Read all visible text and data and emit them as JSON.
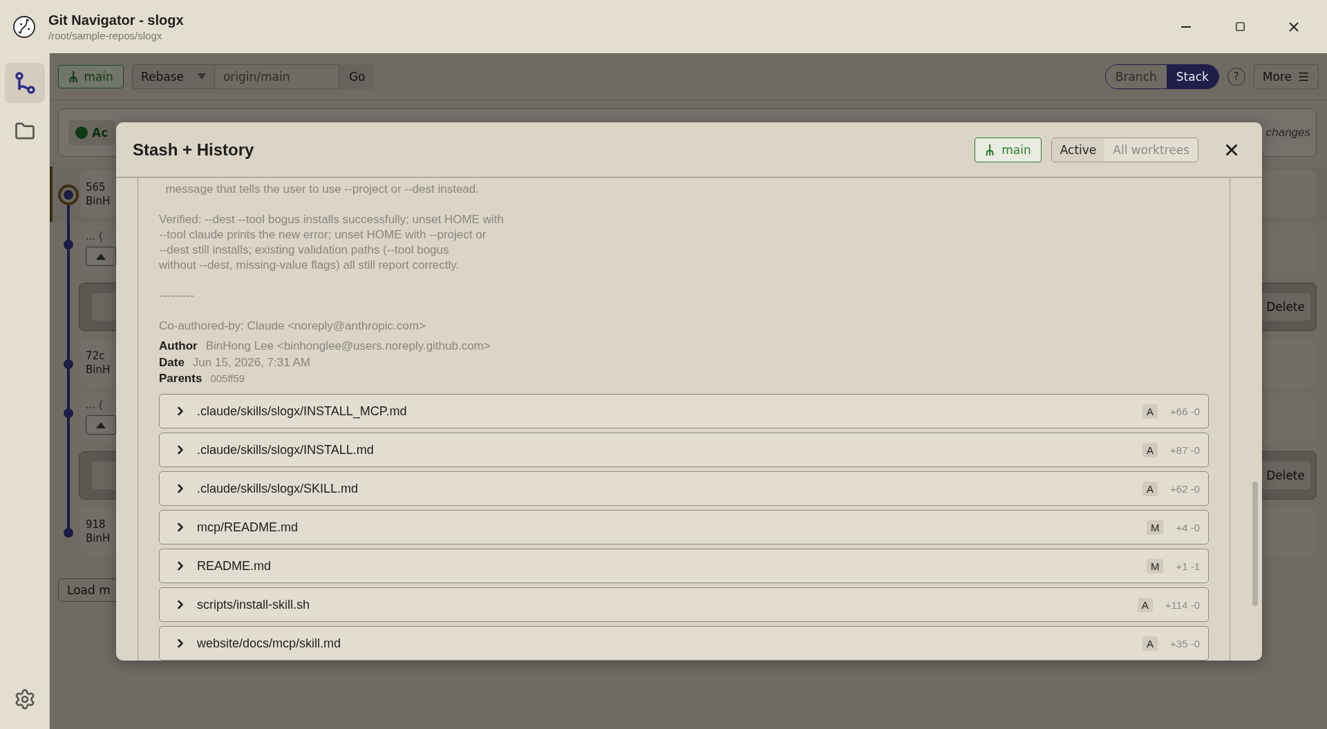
{
  "window": {
    "title": "Git Navigator - slogx",
    "path": "/root/sample-repos/slogx"
  },
  "sidebar": {
    "items": [
      {
        "kind": "graph",
        "selected": true
      },
      {
        "kind": "folder",
        "selected": false
      }
    ]
  },
  "toolbar": {
    "branch": "main",
    "mode": "Rebase",
    "target_placeholder": "origin/main",
    "go": "Go",
    "view_toggle": [
      {
        "label": "Branch",
        "selected": false
      },
      {
        "label": "Stack",
        "selected": true
      }
    ],
    "help": "?",
    "more": "More"
  },
  "background": {
    "status_label": "Ac",
    "status_note": "changes",
    "commits": [
      {
        "kind": "commit",
        "hash": "565",
        "author": "BinH",
        "selected": true
      },
      {
        "kind": "collapsed",
        "text": "... ("
      },
      {
        "kind": "stash",
        "action": "Delete"
      },
      {
        "kind": "commit",
        "hash": "72c",
        "author": "BinH",
        "selected": false
      },
      {
        "kind": "collapsed",
        "text": "... ("
      },
      {
        "kind": "stash",
        "action": "Delete"
      },
      {
        "kind": "commit",
        "hash": "918",
        "author": "BinH",
        "selected": false
      }
    ],
    "load_more": "Load m"
  },
  "modal": {
    "title": "Stash + History",
    "branch": "main",
    "scope_tabs": [
      {
        "label": "Active",
        "selected": true
      },
      {
        "label": "All worktrees",
        "selected": false
      }
    ],
    "message": "  message that tells the user to use --project or --dest instead.\n\nVerified: --dest --tool bogus installs successfully; unset HOME with\n--tool claude prints the new error; unset HOME with --project or\n--dest still installs; existing validation paths (--tool bogus\nwithout --dest, missing-value flags) all still report correctly.\n\n---------\n\nCo-authored-by: Claude <noreply@anthropic.com>",
    "meta": [
      {
        "label": "Author",
        "value": "BinHong Lee <binhonglee@users.noreply.github.com>",
        "kind": "text"
      },
      {
        "label": "Date",
        "value": "Jun 15, 2026, 7:31 AM",
        "kind": "text"
      },
      {
        "label": "Parents",
        "value": "005ff59",
        "kind": "hash"
      }
    ],
    "files": [
      {
        "path": ".claude/skills/slogx/INSTALL_MCP.md",
        "status": "A",
        "stats": "+66 -0"
      },
      {
        "path": ".claude/skills/slogx/INSTALL.md",
        "status": "A",
        "stats": "+87 -0"
      },
      {
        "path": ".claude/skills/slogx/SKILL.md",
        "status": "A",
        "stats": "+62 -0"
      },
      {
        "path": "mcp/README.md",
        "status": "M",
        "stats": "+4 -0"
      },
      {
        "path": "README.md",
        "status": "M",
        "stats": "+1 -1"
      },
      {
        "path": "scripts/install-skill.sh",
        "status": "A",
        "stats": "+114 -0"
      },
      {
        "path": "website/docs/mcp/skill.md",
        "status": "A",
        "stats": "+35 -0"
      }
    ]
  }
}
